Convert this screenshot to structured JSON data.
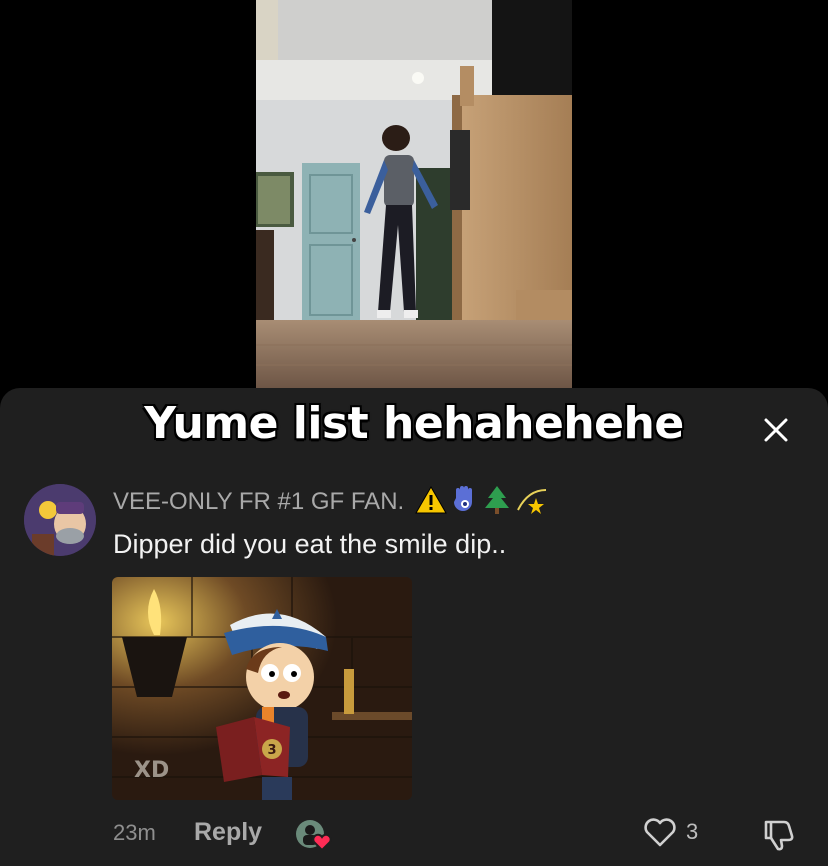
{
  "video": {
    "caption_overlay": "Yume list hehahehehe"
  },
  "comment": {
    "username": "VEE-ONLY FR #1 GF FAN.",
    "badges": [
      "warning-icon",
      "hamsa-icon",
      "tree-icon",
      "dizzy-star-icon"
    ],
    "text": "Dipper did you eat the smile dip..",
    "image_watermark": "XD",
    "image_book_number": "3",
    "time": "23m",
    "reply_label": "Reply",
    "like_count": "3"
  },
  "colors": {
    "sheet_bg": "#1f1f1f",
    "username": "#a9a9a9",
    "comment_text": "#f2f2f2",
    "heart_badge": "#fe2c55",
    "warning": "#f7c600"
  }
}
